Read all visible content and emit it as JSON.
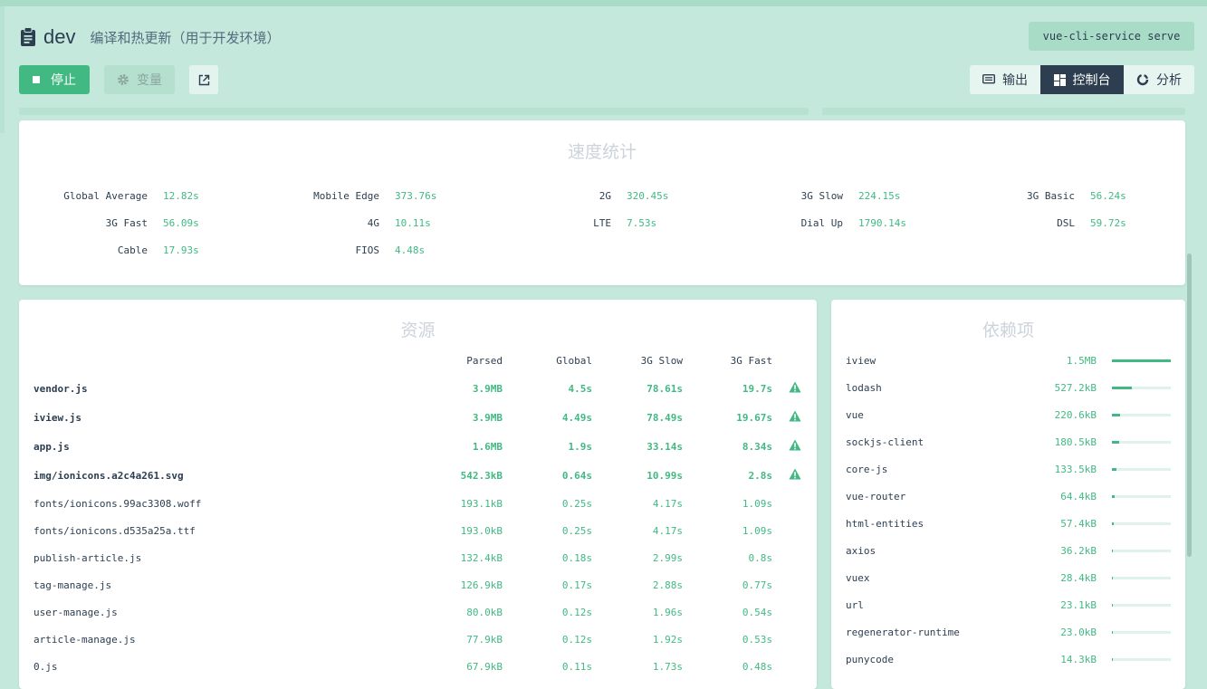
{
  "header": {
    "task_name": "dev",
    "description": "编译和热更新（用于开发环境）",
    "command": "vue-cli-service serve"
  },
  "toolbar": {
    "stop_label": "停止",
    "vars_label": "变量",
    "open_icon": "external-link-icon"
  },
  "views": {
    "output_label": "输出",
    "console_label": "控制台",
    "analyze_label": "分析",
    "active": "控制台"
  },
  "speed_stats": {
    "title": "速度统计",
    "items": [
      {
        "label": "Global Average",
        "value": "12.82s"
      },
      {
        "label": "Mobile Edge",
        "value": "373.76s"
      },
      {
        "label": "2G",
        "value": "320.45s"
      },
      {
        "label": "3G Slow",
        "value": "224.15s"
      },
      {
        "label": "3G Basic",
        "value": "56.24s"
      },
      {
        "label": "3G Fast",
        "value": "56.09s"
      },
      {
        "label": "4G",
        "value": "10.11s"
      },
      {
        "label": "LTE",
        "value": "7.53s"
      },
      {
        "label": "Dial Up",
        "value": "1790.14s"
      },
      {
        "label": "DSL",
        "value": "59.72s"
      },
      {
        "label": "Cable",
        "value": "17.93s"
      },
      {
        "label": "FIOS",
        "value": "4.48s"
      }
    ]
  },
  "assets": {
    "title": "资源",
    "columns": [
      "Parsed",
      "Global",
      "3G Slow",
      "3G Fast"
    ],
    "rows": [
      {
        "name": "vendor.js",
        "parsed": "3.9MB",
        "global": "4.5s",
        "slow": "78.61s",
        "fast": "19.7s",
        "warning": true
      },
      {
        "name": "iview.js",
        "parsed": "3.9MB",
        "global": "4.49s",
        "slow": "78.49s",
        "fast": "19.67s",
        "warning": true
      },
      {
        "name": "app.js",
        "parsed": "1.6MB",
        "global": "1.9s",
        "slow": "33.14s",
        "fast": "8.34s",
        "warning": true
      },
      {
        "name": "img/ionicons.a2c4a261.svg",
        "parsed": "542.3kB",
        "global": "0.64s",
        "slow": "10.99s",
        "fast": "2.8s",
        "warning": true
      },
      {
        "name": "fonts/ionicons.99ac3308.woff",
        "parsed": "193.1kB",
        "global": "0.25s",
        "slow": "4.17s",
        "fast": "1.09s",
        "warning": false
      },
      {
        "name": "fonts/ionicons.d535a25a.ttf",
        "parsed": "193.0kB",
        "global": "0.25s",
        "slow": "4.17s",
        "fast": "1.09s",
        "warning": false
      },
      {
        "name": "publish-article.js",
        "parsed": "132.4kB",
        "global": "0.18s",
        "slow": "2.99s",
        "fast": "0.8s",
        "warning": false
      },
      {
        "name": "tag-manage.js",
        "parsed": "126.9kB",
        "global": "0.17s",
        "slow": "2.88s",
        "fast": "0.77s",
        "warning": false
      },
      {
        "name": "user-manage.js",
        "parsed": "80.0kB",
        "global": "0.12s",
        "slow": "1.96s",
        "fast": "0.54s",
        "warning": false
      },
      {
        "name": "article-manage.js",
        "parsed": "77.9kB",
        "global": "0.12s",
        "slow": "1.92s",
        "fast": "0.53s",
        "warning": false
      },
      {
        "name": "0.js",
        "parsed": "67.9kB",
        "global": "0.11s",
        "slow": "1.73s",
        "fast": "0.48s",
        "warning": false
      }
    ]
  },
  "dependencies": {
    "title": "依赖项",
    "rows": [
      {
        "name": "iview",
        "size": "1.5MB",
        "share": 1.0
      },
      {
        "name": "lodash",
        "size": "527.2kB",
        "share": 0.34
      },
      {
        "name": "vue",
        "size": "220.6kB",
        "share": 0.14
      },
      {
        "name": "sockjs-client",
        "size": "180.5kB",
        "share": 0.12
      },
      {
        "name": "core-js",
        "size": "133.5kB",
        "share": 0.08
      },
      {
        "name": "vue-router",
        "size": "64.4kB",
        "share": 0.04
      },
      {
        "name": "html-entities",
        "size": "57.4kB",
        "share": 0.035
      },
      {
        "name": "axios",
        "size": "36.2kB",
        "share": 0.02
      },
      {
        "name": "vuex",
        "size": "28.4kB",
        "share": 0.017
      },
      {
        "name": "url",
        "size": "23.1kB",
        "share": 0.014
      },
      {
        "name": "regenerator-runtime",
        "size": "23.0kB",
        "share": 0.014
      },
      {
        "name": "punycode",
        "size": "14.3kB",
        "share": 0.009
      }
    ]
  },
  "colors": {
    "accent": "#42b983",
    "dark": "#2c3e50",
    "background": "#c4e9dc",
    "warning": "#42b983"
  }
}
